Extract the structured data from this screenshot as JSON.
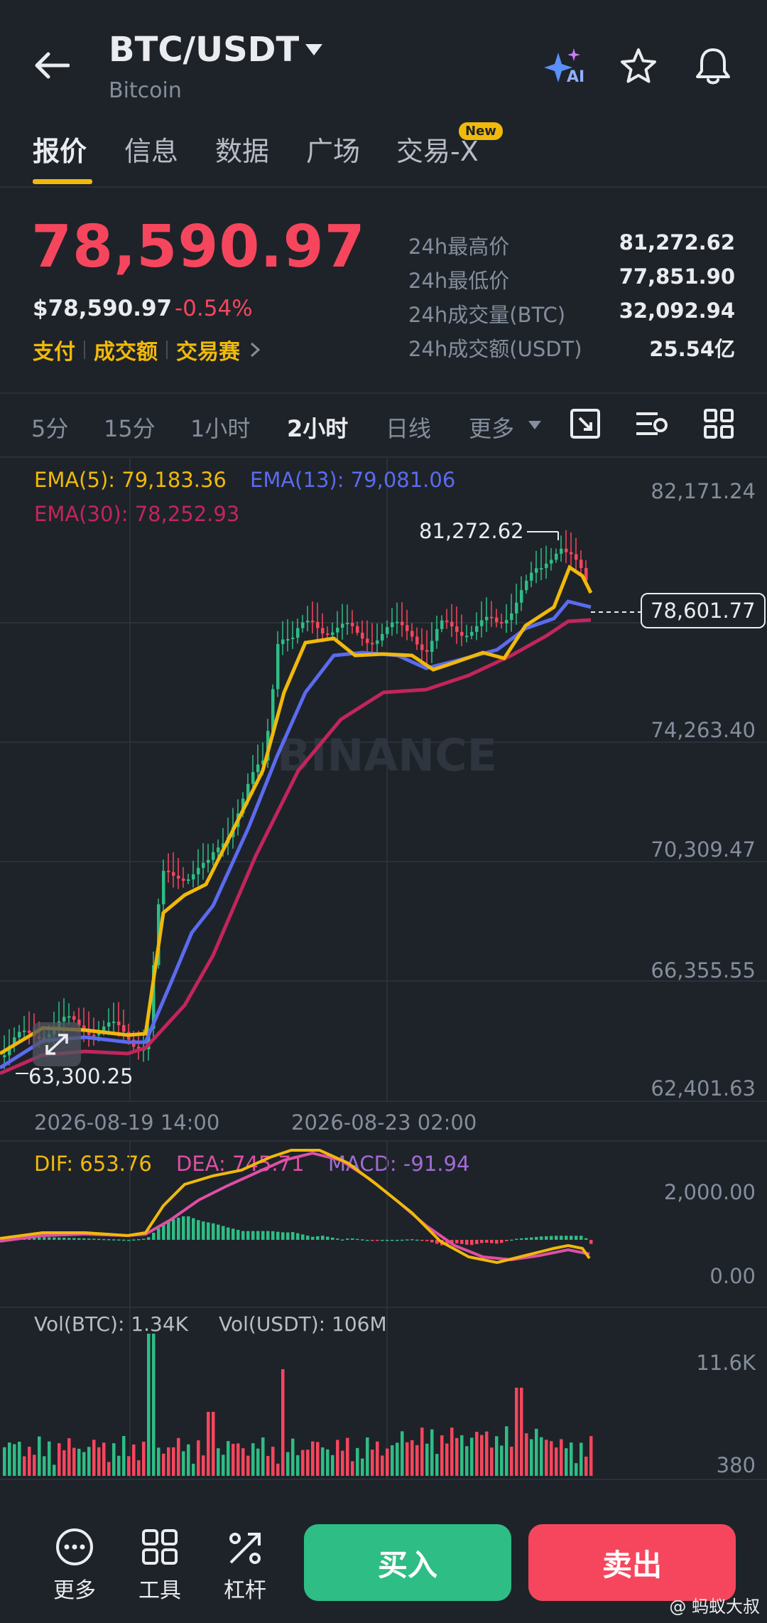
{
  "header": {
    "pair": "BTC/USDT",
    "name": "Bitcoin",
    "ai_badge": "AI",
    "icons": [
      "back-arrow-icon",
      "dropdown-caret-icon",
      "ai-sparkle-icon",
      "star-icon",
      "bell-icon"
    ]
  },
  "tabs": [
    {
      "label": "报价",
      "active": true
    },
    {
      "label": "信息"
    },
    {
      "label": "数据"
    },
    {
      "label": "广场"
    },
    {
      "label": "交易-X",
      "badge": "New"
    }
  ],
  "price": {
    "last": "78,590.97",
    "usd": "$78,590.97",
    "change": "-0.54%",
    "links": [
      "支付",
      "成交额",
      "交易赛"
    ]
  },
  "stats": [
    {
      "label": "24h最高价",
      "value": "81,272.62"
    },
    {
      "label": "24h最低价",
      "value": "77,851.90"
    },
    {
      "label": "24h成交量(BTC)",
      "value": "32,092.94"
    },
    {
      "label": "24h成交额(USDT)",
      "value": "25.54亿"
    }
  ],
  "timeframes": [
    {
      "label": "5分"
    },
    {
      "label": "15分"
    },
    {
      "label": "1小时"
    },
    {
      "label": "2小时",
      "active": true
    },
    {
      "label": "日线"
    },
    {
      "label": "更多"
    }
  ],
  "toolbar_icons": [
    "chart-fullscreen-icon",
    "indicator-settings-icon",
    "layout-grid-icon"
  ],
  "ema": {
    "ema5": "EMA(5): 79,183.36",
    "ema13": "EMA(13): 79,081.06",
    "ema30": "EMA(30): 78,252.93"
  },
  "price_axis": [
    "82,171.24",
    "74,263.40",
    "70,309.47",
    "66,355.55",
    "62,401.63"
  ],
  "high_label": "81,272.62",
  "low_label": "63,300.25",
  "current_tag": "78,601.77",
  "watermark": "BINANCE",
  "time_axis": [
    "2026-08-19 14:00",
    "2026-08-23 02:00"
  ],
  "macd": {
    "dif": "DIF: 653.76",
    "dea": "DEA: 745.71",
    "macd": "MACD: -91.94",
    "axis": [
      "2,000.00",
      "0.00"
    ]
  },
  "vol": {
    "btc": "Vol(BTC): 1.34K",
    "usdt": "Vol(USDT): 106M",
    "axis": [
      "11.6K",
      "380"
    ]
  },
  "bottom": {
    "more": "更多",
    "tools": "工具",
    "leverage": "杠杆",
    "buy": "买入",
    "sell": "卖出"
  },
  "credit": "@ 蚂蚁大叔",
  "colors": {
    "up": "#2ebd85",
    "down": "#f6465d",
    "ema5": "#f0b90b",
    "ema13": "#5b6bf0",
    "ema30": "#c2255c",
    "dif": "#f0b90b",
    "dea": "#e04fa5",
    "macd": "#a06cd5"
  }
}
